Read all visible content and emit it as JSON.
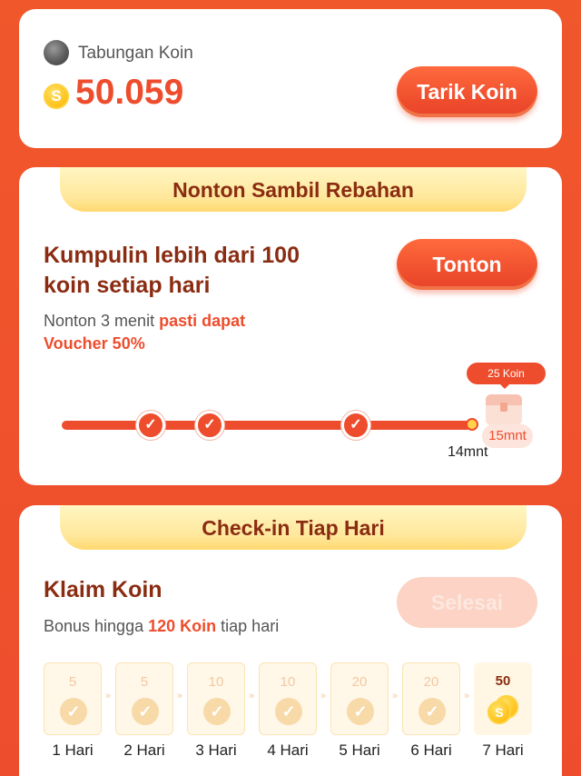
{
  "savings": {
    "label": "Tabungan Koin",
    "amount": "50.059",
    "coin_symbol": "S",
    "withdraw_button": "Tarik Koin"
  },
  "watch": {
    "banner": "Nonton Sambil Rebahan",
    "heading_line1": "Kumpulin lebih dari 100",
    "heading_line2": "koin setiap hari",
    "sub_prefix": "Nonton 3 menit",
    "sub_accent1": "pasti dapat",
    "sub_accent2": "Voucher 50%",
    "button": "Tonton",
    "checkpoints_completed": 3,
    "reward_tooltip": "25 Koin",
    "target_time": "15mnt",
    "current_time": "14mnt"
  },
  "checkin": {
    "banner": "Check-in Tiap Hari",
    "heading": "Klaim Koin",
    "sub_prefix": "Bonus hingga",
    "sub_accent": "120 Koin",
    "sub_suffix": "tiap hari",
    "button": "Selesai",
    "days": [
      {
        "label": "1 Hari",
        "coins": "5",
        "claimed": true
      },
      {
        "label": "2 Hari",
        "coins": "5",
        "claimed": true
      },
      {
        "label": "3 Hari",
        "coins": "10",
        "claimed": true
      },
      {
        "label": "4 Hari",
        "coins": "10",
        "claimed": true
      },
      {
        "label": "5 Hari",
        "coins": "20",
        "claimed": true
      },
      {
        "label": "6 Hari",
        "coins": "20",
        "claimed": true
      },
      {
        "label": "7 Hari",
        "coins": "50",
        "claimed": false
      }
    ],
    "arrow_glyph": "»"
  },
  "colors": {
    "brand": "#ee4d2d",
    "banner_text": "#8a2c12",
    "banner_bg": "#ffe79a"
  }
}
